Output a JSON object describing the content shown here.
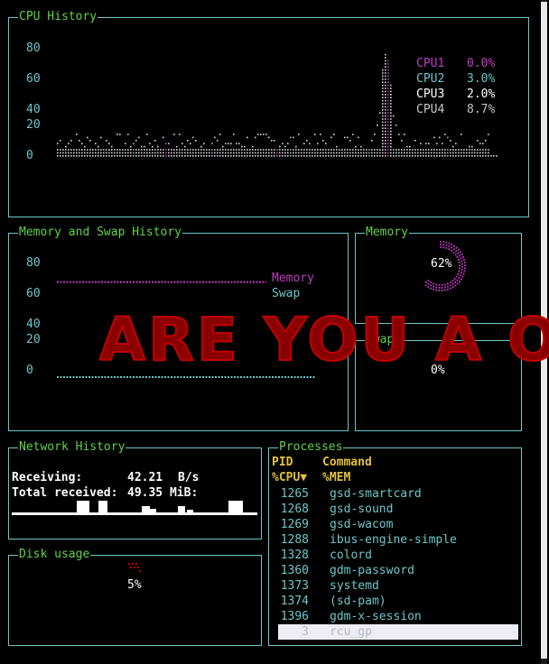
{
  "cpu": {
    "title": "CPU History",
    "yticks": [
      "80",
      "60",
      "40",
      "20",
      "0"
    ],
    "legend": [
      {
        "label": "CPU1",
        "value": "0.0%",
        "color": "#c23cc2"
      },
      {
        "label": "CPU2",
        "value": "3.0%",
        "color": "#6fc6c8"
      },
      {
        "label": "CPU3",
        "value": "2.0%",
        "color": "#ffffff"
      },
      {
        "label": "CPU4",
        "value": "8.7%",
        "color": "#c8c8c8"
      }
    ]
  },
  "memswap": {
    "title": "Memory and Swap History",
    "yticks": [
      "80",
      "60",
      "40",
      "20",
      "0"
    ],
    "legend": [
      {
        "label": "Memory",
        "color": "#c23cc2"
      },
      {
        "label": "Swap",
        "color": "#6fc6c8"
      }
    ],
    "memory_level": 62,
    "swap_level": 0
  },
  "memory": {
    "title": "Memory",
    "percent_text": "62%",
    "level": 0.62
  },
  "swap": {
    "title": "Swap",
    "percent_text": "0%",
    "level": 0.0
  },
  "banner": {
    "text": "ARE YOU A OK"
  },
  "network": {
    "title": "Network History",
    "receiving_label": "Receiving:",
    "receiving_value": "42.21",
    "receiving_unit": "B/s",
    "total_label": "Total received:",
    "total_value": "49.35 MiB:"
  },
  "disk": {
    "title": "Disk usage",
    "percent_text": "5%",
    "level": 0.05
  },
  "processes": {
    "title": "Processes",
    "header_pid": "PID",
    "header_command": "Command",
    "header_cpu": "%CPU▼",
    "header_mem": "%MEM",
    "rows": [
      {
        "pid": "1265",
        "command": "gsd-smartcard"
      },
      {
        "pid": "1268",
        "command": "gsd-sound"
      },
      {
        "pid": "1269",
        "command": "gsd-wacom"
      },
      {
        "pid": "1288",
        "command": "ibus-engine-simple"
      },
      {
        "pid": "1328",
        "command": "colord"
      },
      {
        "pid": "1360",
        "command": "gdm-password"
      },
      {
        "pid": "1373",
        "command": "systemd"
      },
      {
        "pid": "1374",
        "command": "(sd-pam)"
      },
      {
        "pid": "1396",
        "command": "gdm-x-session"
      },
      {
        "pid": "3",
        "command": "rcu_gp"
      }
    ]
  },
  "colors": {
    "border": "#6fc6c8",
    "title": "#5fd24a",
    "memory": "#c23cc2",
    "swap": "#6fc6c8",
    "header": "#e0c040",
    "banner": "#c40000"
  }
}
